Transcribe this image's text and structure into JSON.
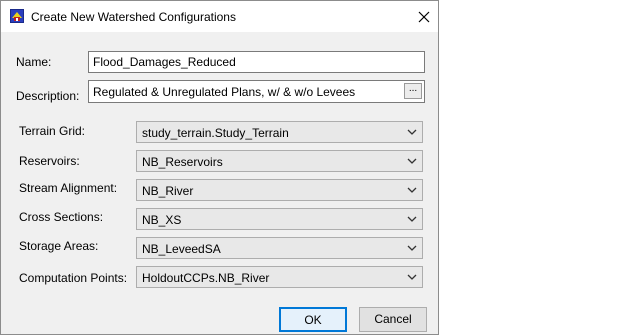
{
  "window": {
    "title": "Create New Watershed Configurations",
    "app_icon": "hec-ras-icon",
    "close_icon": "close-icon"
  },
  "form": {
    "name_label": "Name:",
    "name_value": "Flood_Damages_Reduced",
    "description_label": "Description:",
    "description_value": "Regulated & Unregulated Plans, w/ & w/o Levees",
    "browse_label": "..."
  },
  "selections": [
    {
      "label": "Terrain Grid:",
      "value": "study_terrain.Study_Terrain"
    },
    {
      "label": "Reservoirs:",
      "value": "NB_Reservoirs"
    },
    {
      "label": "Stream Alignment:",
      "value": "NB_River"
    },
    {
      "label": "Cross Sections:",
      "value": "NB_XS"
    },
    {
      "label": "Storage Areas:",
      "value": "NB_LeveedSA"
    },
    {
      "label": "Computation Points:",
      "value": "HoldoutCCPs.NB_River"
    }
  ],
  "buttons": {
    "ok": "OK",
    "cancel": "Cancel"
  },
  "colors": {
    "dialog_bg": "#f0f0f0",
    "ok_border": "#0078d7",
    "ok_bg": "#e5f1fb"
  }
}
